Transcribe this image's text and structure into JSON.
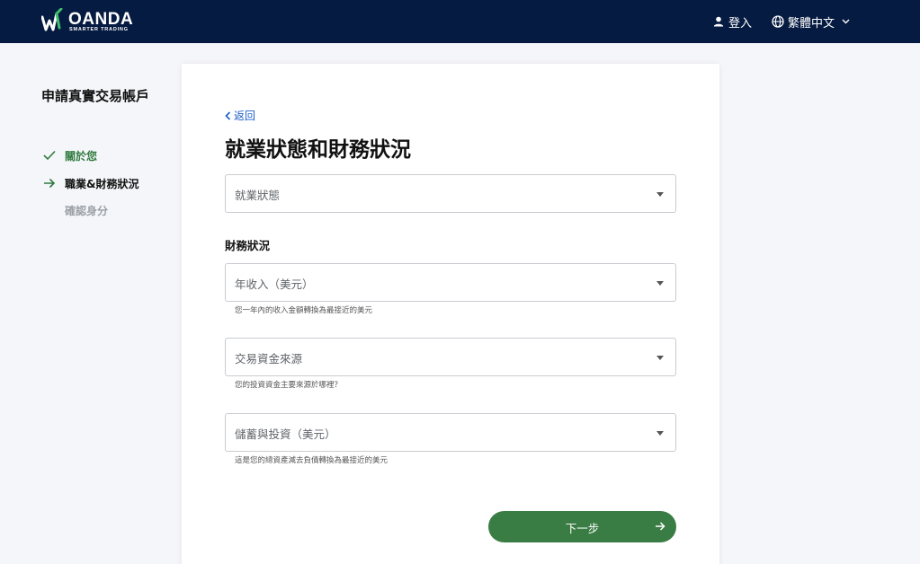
{
  "header": {
    "logo": {
      "word": "OANDA",
      "tagline": "SMARTER TRADING"
    },
    "login_label": "登入",
    "language_label": "繁體中文",
    "colors": {
      "background": "#051b41",
      "text": "#ffffff",
      "logo_accent": "#3fbf6b"
    }
  },
  "sidebar": {
    "title": "申請真實交易帳戶",
    "steps": [
      {
        "label": "關於您",
        "state": "done",
        "icon": "check-icon"
      },
      {
        "label": "職業&財務狀況",
        "state": "current",
        "icon": "arrow-right-icon"
      },
      {
        "label": "確認身分",
        "state": "pending"
      }
    ]
  },
  "form": {
    "back_label": "返回",
    "title": "就業狀態和財務狀況",
    "employment": {
      "placeholder": "就業狀態"
    },
    "financial_section_label": "財務狀況",
    "fields": [
      {
        "placeholder": "年收入（美元）",
        "help": "您一年內的收入金額轉換為最接近的美元"
      },
      {
        "placeholder": "交易資金來源",
        "help": "您的投資資金主要來源於哪裡？"
      },
      {
        "placeholder": "儲蓄與投資（美元）",
        "help": "這是您的總資產減去負債轉換為最接近的美元"
      }
    ],
    "next_label": "下一步",
    "colors": {
      "primary_button": "#3a7d44",
      "link": "#1a5cc8",
      "done_step": "#2f7a3e",
      "pending_step": "#9aa0a6"
    }
  }
}
